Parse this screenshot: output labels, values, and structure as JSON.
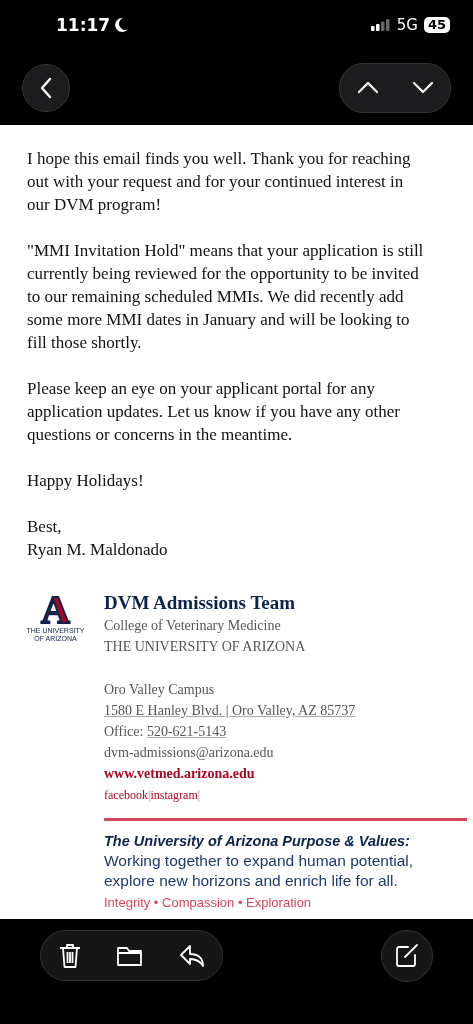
{
  "status_bar": {
    "time": "11:17",
    "network": "5G",
    "battery": "45"
  },
  "email": {
    "paragraphs": [
      "I hope this email finds you well. Thank you for reaching out with your request and for your continued interest in our DVM program!",
      "\"MMI Invitation Hold\" means that your application is still currently being reviewed for the opportunity to be invited to our remaining scheduled MMIs. We did recently add some more MMI dates in January and will be looking to fill those shortly.",
      "Please keep an eye on your applicant portal for any application updates. Let us know if you have any other questions or concerns in the meantime.",
      "Happy Holidays!"
    ],
    "closing": [
      "Best,",
      "Ryan M. Maldonado"
    ]
  },
  "signature": {
    "logo": {
      "letter": "A",
      "lines": [
        "THE UNIVERSITY",
        "OF ARIZONA"
      ]
    },
    "title": "DVM Admissions Team",
    "subtitle": [
      "College of Veterinary Medicine",
      "THE UNIVERSITY OF ARIZONA"
    ],
    "campus": "Oro Valley Campus",
    "address": "1580 E Hanley Blvd. | Oro Valley, AZ 85737",
    "office_label": "Office:",
    "phone": "520-621-5143",
    "email": "dvm-admissions@arizona.edu",
    "website": "www.vetmed.arizona.edu",
    "social": [
      "facebook",
      "instagram"
    ],
    "separator": "|"
  },
  "values": {
    "heading": "The University of Arizona Purpose & Values:",
    "text": "Working together to expand human potential, explore new horizons and enrich life for all.",
    "list": "Integrity • Compassion • Exploration"
  }
}
